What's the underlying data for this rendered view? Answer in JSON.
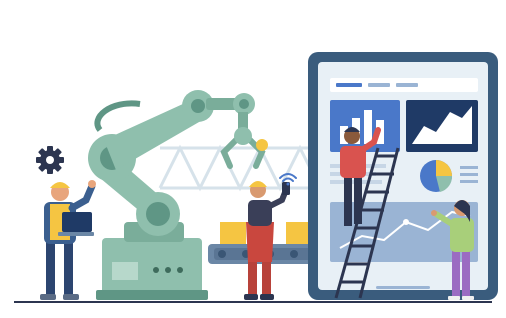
{
  "colors": {
    "robot_body": "#8fbfad",
    "robot_dark": "#5f9685",
    "robot_light": "#b7d8cb",
    "tablet_frame": "#3a5c7d",
    "tablet_screen": "#e8f0f6",
    "panel_blue": "#4a78c9",
    "panel_navy": "#1f3a66",
    "accent_yellow": "#f5c542",
    "ground_line": "#2c3550"
  },
  "icons": {
    "gear": "gear-icon",
    "wifi": "wifi-icon",
    "pie_chart": "pie-chart-icon",
    "bar_chart": "bar-chart-icon",
    "area_chart": "area-chart-icon",
    "laptop": "laptop-icon"
  }
}
